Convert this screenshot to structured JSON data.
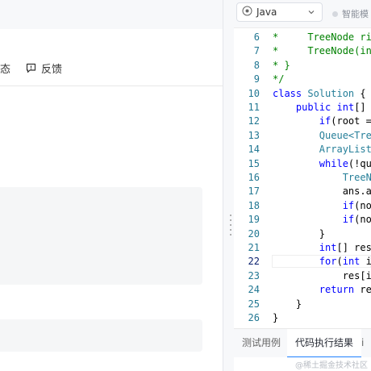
{
  "left_panel": {
    "status_fragment": "态",
    "feedback_label": "反馈"
  },
  "editor": {
    "language_label": "Java",
    "smart_mode_label": "智能模",
    "lines": [
      {
        "num": "6",
        "tokens": [
          {
            "t": "*     TreeNode ri",
            "c": "c-com"
          }
        ]
      },
      {
        "num": "7",
        "tokens": [
          {
            "t": "*     TreeNode(in",
            "c": "c-com"
          }
        ]
      },
      {
        "num": "8",
        "tokens": [
          {
            "t": "* }",
            "c": "c-com"
          }
        ]
      },
      {
        "num": "9",
        "tokens": [
          {
            "t": "*/",
            "c": "c-com"
          }
        ]
      },
      {
        "num": "10",
        "tokens": [
          {
            "t": "class",
            "c": "c-kw"
          },
          {
            "t": " ",
            "c": "c-def"
          },
          {
            "t": "Solution",
            "c": "c-type"
          },
          {
            "t": " {",
            "c": "c-def"
          }
        ]
      },
      {
        "num": "11",
        "tokens": [
          {
            "t": "    ",
            "c": "c-def"
          },
          {
            "t": "public",
            "c": "c-kw"
          },
          {
            "t": " ",
            "c": "c-def"
          },
          {
            "t": "int",
            "c": "c-kw"
          },
          {
            "t": "[] l",
            "c": "c-def"
          }
        ]
      },
      {
        "num": "12",
        "tokens": [
          {
            "t": "        ",
            "c": "c-def"
          },
          {
            "t": "if",
            "c": "c-kw"
          },
          {
            "t": "(root ==",
            "c": "c-def"
          }
        ]
      },
      {
        "num": "13",
        "tokens": [
          {
            "t": "        ",
            "c": "c-def"
          },
          {
            "t": "Queue<Tree",
            "c": "c-type"
          }
        ]
      },
      {
        "num": "14",
        "tokens": [
          {
            "t": "        ",
            "c": "c-def"
          },
          {
            "t": "ArrayList<",
            "c": "c-type"
          }
        ]
      },
      {
        "num": "15",
        "tokens": [
          {
            "t": "        ",
            "c": "c-def"
          },
          {
            "t": "while",
            "c": "c-kw"
          },
          {
            "t": "(!que",
            "c": "c-def"
          }
        ]
      },
      {
        "num": "16",
        "tokens": [
          {
            "t": "            ",
            "c": "c-def"
          },
          {
            "t": "TreeNo",
            "c": "c-type"
          }
        ]
      },
      {
        "num": "17",
        "tokens": [
          {
            "t": "            ans.ad",
            "c": "c-def"
          }
        ]
      },
      {
        "num": "18",
        "tokens": [
          {
            "t": "            ",
            "c": "c-def"
          },
          {
            "t": "if",
            "c": "c-kw"
          },
          {
            "t": "(noc",
            "c": "c-def"
          }
        ]
      },
      {
        "num": "19",
        "tokens": [
          {
            "t": "            ",
            "c": "c-def"
          },
          {
            "t": "if",
            "c": "c-kw"
          },
          {
            "t": "(noc",
            "c": "c-def"
          }
        ]
      },
      {
        "num": "20",
        "tokens": [
          {
            "t": "        }",
            "c": "c-def"
          }
        ]
      },
      {
        "num": "21",
        "tokens": [
          {
            "t": "        ",
            "c": "c-def"
          },
          {
            "t": "int",
            "c": "c-kw"
          },
          {
            "t": "[] res",
            "c": "c-def"
          }
        ]
      },
      {
        "num": "22",
        "active": true,
        "tokens": [
          {
            "t": "        ",
            "c": "c-def"
          },
          {
            "t": "for",
            "c": "c-kw"
          },
          {
            "t": "(",
            "c": "c-def"
          },
          {
            "t": "int",
            "c": "c-kw"
          },
          {
            "t": " i=",
            "c": "c-def"
          }
        ]
      },
      {
        "num": "23",
        "tokens": [
          {
            "t": "            res[i]",
            "c": "c-def"
          }
        ]
      },
      {
        "num": "24",
        "tokens": [
          {
            "t": "        ",
            "c": "c-def"
          },
          {
            "t": "return",
            "c": "c-kw"
          },
          {
            "t": " res",
            "c": "c-def"
          }
        ]
      },
      {
        "num": "25",
        "tokens": [
          {
            "t": "    }",
            "c": "c-def"
          }
        ]
      },
      {
        "num": "26",
        "tokens": [
          {
            "t": "}",
            "c": "c-def"
          }
        ]
      }
    ]
  },
  "bottom_tabs": [
    {
      "label": "测试用例",
      "active": false
    },
    {
      "label": "代码执行结果",
      "active": true
    },
    {
      "label": "i",
      "active": false
    }
  ],
  "watermark": "@稀土掘金技术社区"
}
